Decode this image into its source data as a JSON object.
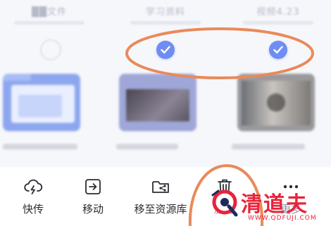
{
  "grid": {
    "columns": [
      {
        "label": "██文件",
        "selected": false,
        "thumb": "folder"
      },
      {
        "label": "学习资料",
        "selected": true,
        "thumb": "photo"
      },
      {
        "label": "视频4.23",
        "selected": true,
        "thumb": "video"
      }
    ]
  },
  "colors": {
    "accent": "#6f8df2",
    "annotation": "#e98a5a",
    "watermark": "#e8233a"
  },
  "toolbar": {
    "items": [
      {
        "label": "快传",
        "icon": "cloud-lightning-icon"
      },
      {
        "label": "移动",
        "icon": "move-arrow-icon"
      },
      {
        "label": "移至资源库",
        "icon": "folder-share-icon"
      },
      {
        "label": "删除",
        "icon": "trash-icon"
      },
      {
        "label": "更多",
        "icon": "more-dots-icon"
      }
    ]
  },
  "watermark": {
    "text": "清道夫",
    "url": "WWW.QDFUJI.COM"
  }
}
